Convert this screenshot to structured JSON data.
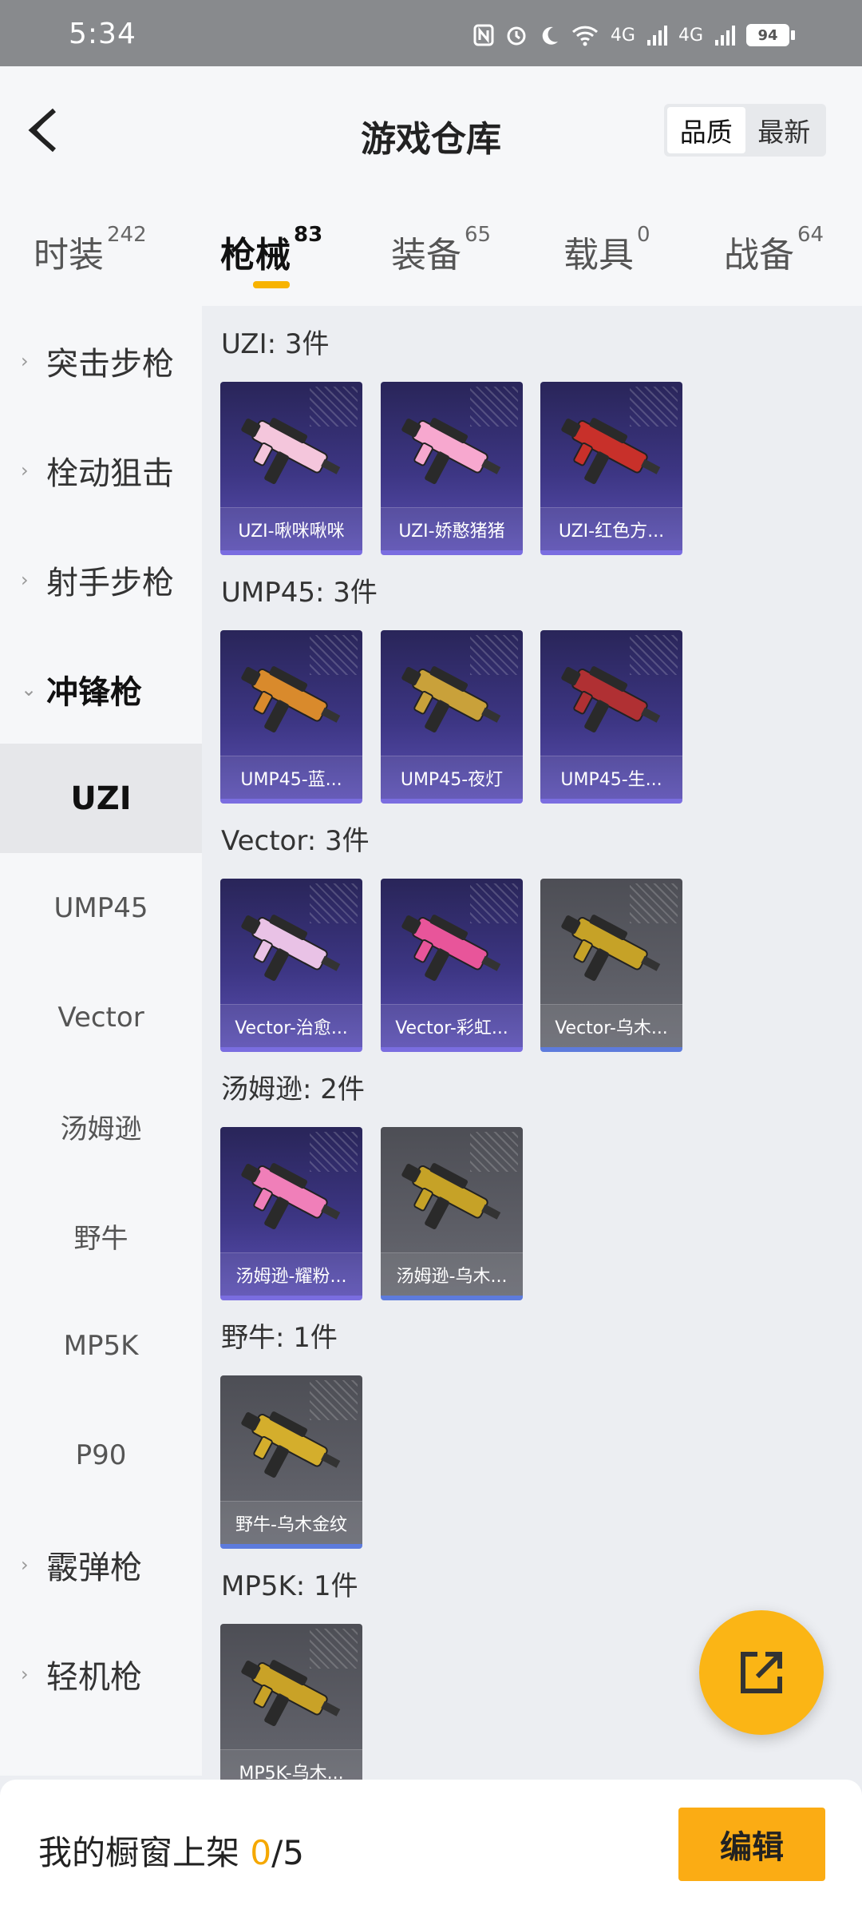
{
  "status_bar": {
    "time": "5:34",
    "signal_label": "4G",
    "battery": "94"
  },
  "header": {
    "title": "游戏仓库",
    "sort_options": [
      "品质",
      "最新"
    ],
    "sort_selected": "品质"
  },
  "category_tabs": [
    {
      "label": "时装",
      "count": "242"
    },
    {
      "label": "枪械",
      "count": "83",
      "selected": true
    },
    {
      "label": "装备",
      "count": "65"
    },
    {
      "label": "载具",
      "count": "0"
    },
    {
      "label": "战备",
      "count": "64"
    }
  ],
  "sidebar": {
    "groups_top": [
      "突击步枪",
      "栓动狙击",
      "射手步枪"
    ],
    "open_group": "冲锋枪",
    "sub_items": [
      "UZI",
      "UMP45",
      "Vector",
      "汤姆逊",
      "野牛",
      "MP5K",
      "P90"
    ],
    "sub_selected": "UZI",
    "groups_bottom": [
      "霰弹枪",
      "轻机枪"
    ]
  },
  "sections": [
    {
      "title": "UZI: 3件",
      "items": [
        {
          "name": "UZI-啾咪啾咪",
          "rarity": "purple",
          "color": "#f4c6dc"
        },
        {
          "name": "UZI-娇憨猪猪",
          "rarity": "purple",
          "color": "#f7a8cf"
        },
        {
          "name": "UZI-红色方...",
          "rarity": "purple",
          "color": "#c8302a"
        }
      ]
    },
    {
      "title": "UMP45: 3件",
      "items": [
        {
          "name": "UMP45-蓝...",
          "rarity": "purple",
          "color": "#d98a2c"
        },
        {
          "name": "UMP45-夜灯",
          "rarity": "purple",
          "color": "#c9a13a"
        },
        {
          "name": "UMP45-生...",
          "rarity": "purple",
          "color": "#b03033"
        }
      ]
    },
    {
      "title": "Vector: 3件",
      "items": [
        {
          "name": "Vector-治愈...",
          "rarity": "purple",
          "color": "#e9c2e6"
        },
        {
          "name": "Vector-彩虹...",
          "rarity": "purple",
          "color": "#e8559a"
        },
        {
          "name": "Vector-乌木...",
          "rarity": "gray",
          "color": "#c6a227"
        }
      ]
    },
    {
      "title": "汤姆逊: 2件",
      "items": [
        {
          "name": "汤姆逊-耀粉...",
          "rarity": "purple",
          "color": "#f07fb9"
        },
        {
          "name": "汤姆逊-乌木...",
          "rarity": "gray",
          "color": "#c6a227"
        }
      ]
    },
    {
      "title": "野牛: 1件",
      "items": [
        {
          "name": "野牛-乌木金纹",
          "rarity": "gray",
          "color": "#d4ae2c"
        }
      ]
    },
    {
      "title": "MP5K: 1件",
      "items": [
        {
          "name": "MP5K-乌木...",
          "rarity": "gray",
          "color": "#c9a227"
        }
      ]
    }
  ],
  "fab": {
    "icon": "share-external-icon"
  },
  "bottom": {
    "label_prefix": "我的橱窗上架 ",
    "current": "0",
    "separator": "/5",
    "edit_label": "编辑"
  },
  "colors": {
    "accent": "#f7b300",
    "purple_card": "#3d3684",
    "gray_card": "#5d5e66"
  }
}
